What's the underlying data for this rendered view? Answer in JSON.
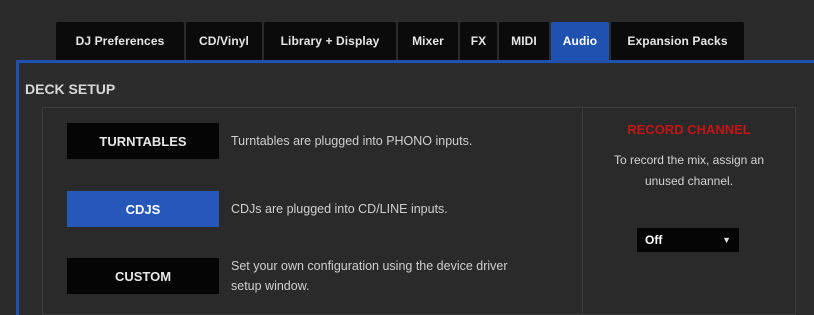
{
  "tabs": [
    {
      "label": "DJ Preferences",
      "active": false
    },
    {
      "label": "CD/Vinyl",
      "active": false
    },
    {
      "label": "Library + Display",
      "active": false
    },
    {
      "label": "Mixer",
      "active": false
    },
    {
      "label": "FX",
      "active": false
    },
    {
      "label": "MIDI",
      "active": false
    },
    {
      "label": "Audio",
      "active": true
    },
    {
      "label": "Expansion Packs",
      "active": false
    }
  ],
  "deck_setup": {
    "title": "DECK SETUP",
    "options": [
      {
        "label": "TURNTABLES",
        "description": "Turntables are plugged into PHONO inputs.",
        "selected": false
      },
      {
        "label": "CDJS",
        "description": "CDJs are plugged into CD/LINE inputs.",
        "selected": true
      },
      {
        "label": "CUSTOM",
        "description": "Set your own configuration using the device driver setup window.",
        "selected": false
      }
    ]
  },
  "record_channel": {
    "title": "RECORD CHANNEL",
    "text": "To record the mix, assign an unused channel.",
    "selected_value": "Off"
  },
  "colors": {
    "accent": "#1f52b0",
    "record_title": "#c41414",
    "button_bg": "#050505"
  }
}
